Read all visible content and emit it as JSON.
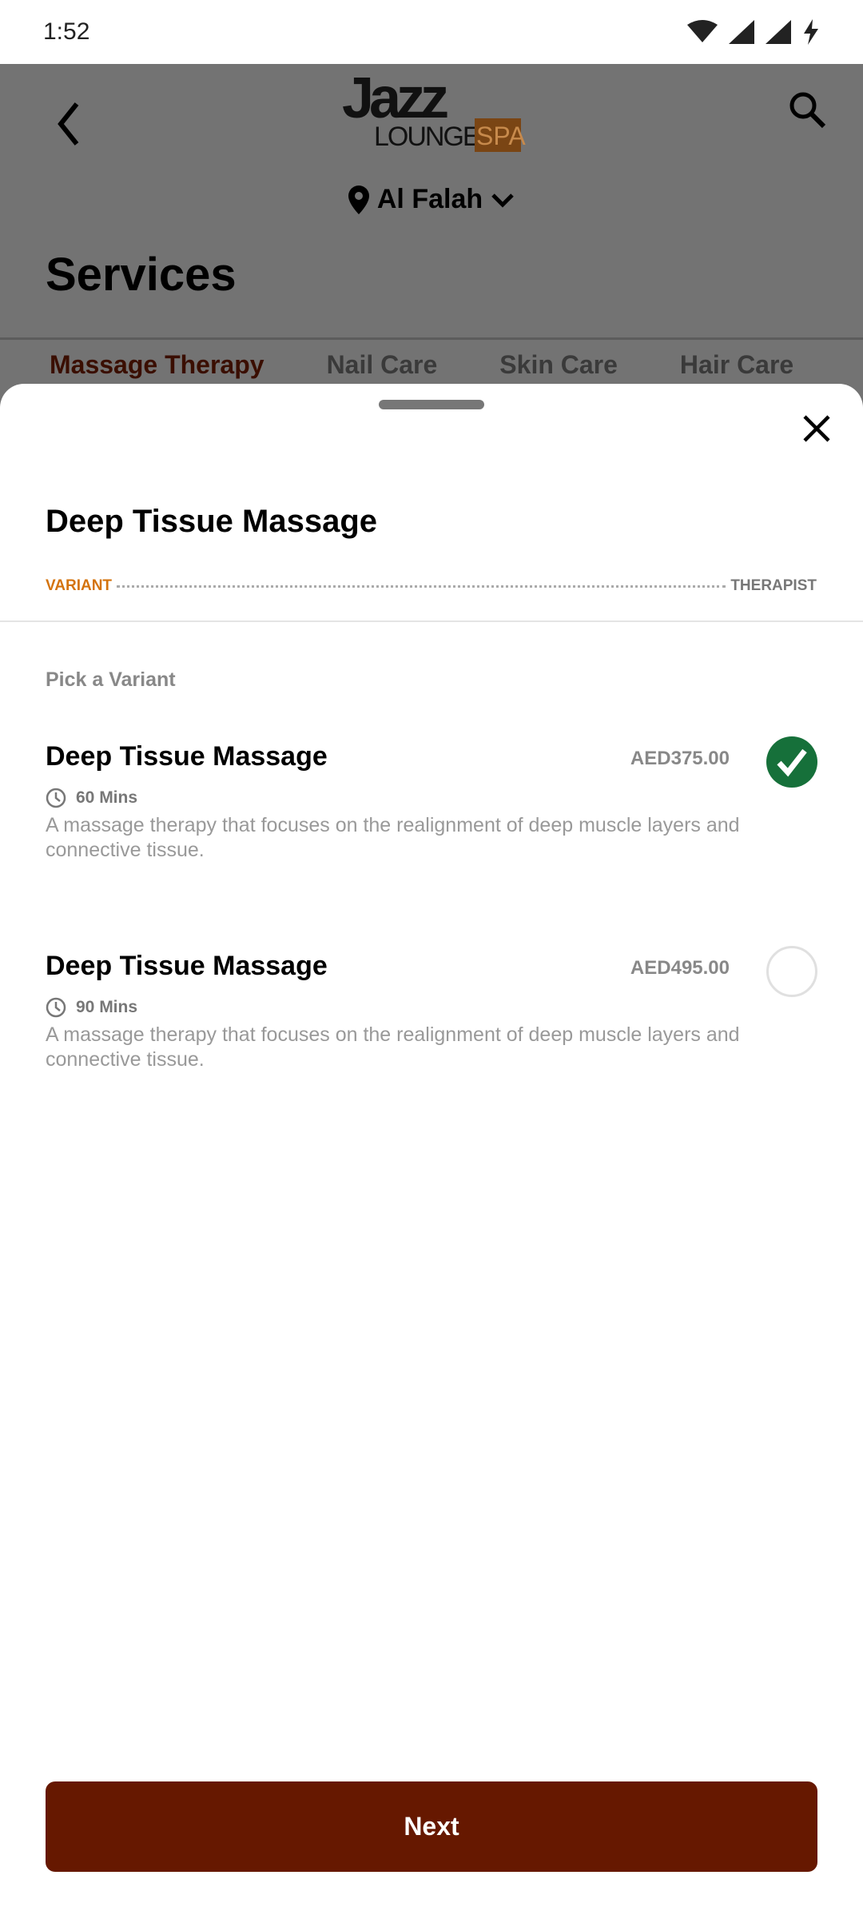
{
  "status_bar": {
    "time": "1:52"
  },
  "header": {
    "logo": {
      "line1": "Jazz",
      "line2": "LOUNGE",
      "line3": "SPA"
    },
    "location": "Al Falah",
    "page_title": "Services"
  },
  "tabs": [
    {
      "label": "Massage Therapy",
      "active": true
    },
    {
      "label": "Nail Care"
    },
    {
      "label": "Skin Care"
    },
    {
      "label": "Hair Care"
    }
  ],
  "sheet": {
    "title": "Deep Tissue Massage",
    "steps": [
      "VARIANT",
      "THERAPIST"
    ],
    "section_label": "Pick a Variant",
    "variants": [
      {
        "name": "Deep Tissue Massage",
        "price": "AED375.00",
        "duration": "60 Mins",
        "description": "A massage therapy that focuses on the realignment of deep muscle layers and connective tissue.",
        "selected": true
      },
      {
        "name": "Deep Tissue Massage",
        "price": "AED495.00",
        "duration": "90 Mins",
        "description": "A massage therapy that focuses on the realignment of deep muscle layers and connective tissue.",
        "selected": false
      }
    ],
    "next_label": "Next"
  },
  "colors": {
    "brand": "#661800",
    "accent": "#d4730d",
    "selected": "#16703a"
  }
}
